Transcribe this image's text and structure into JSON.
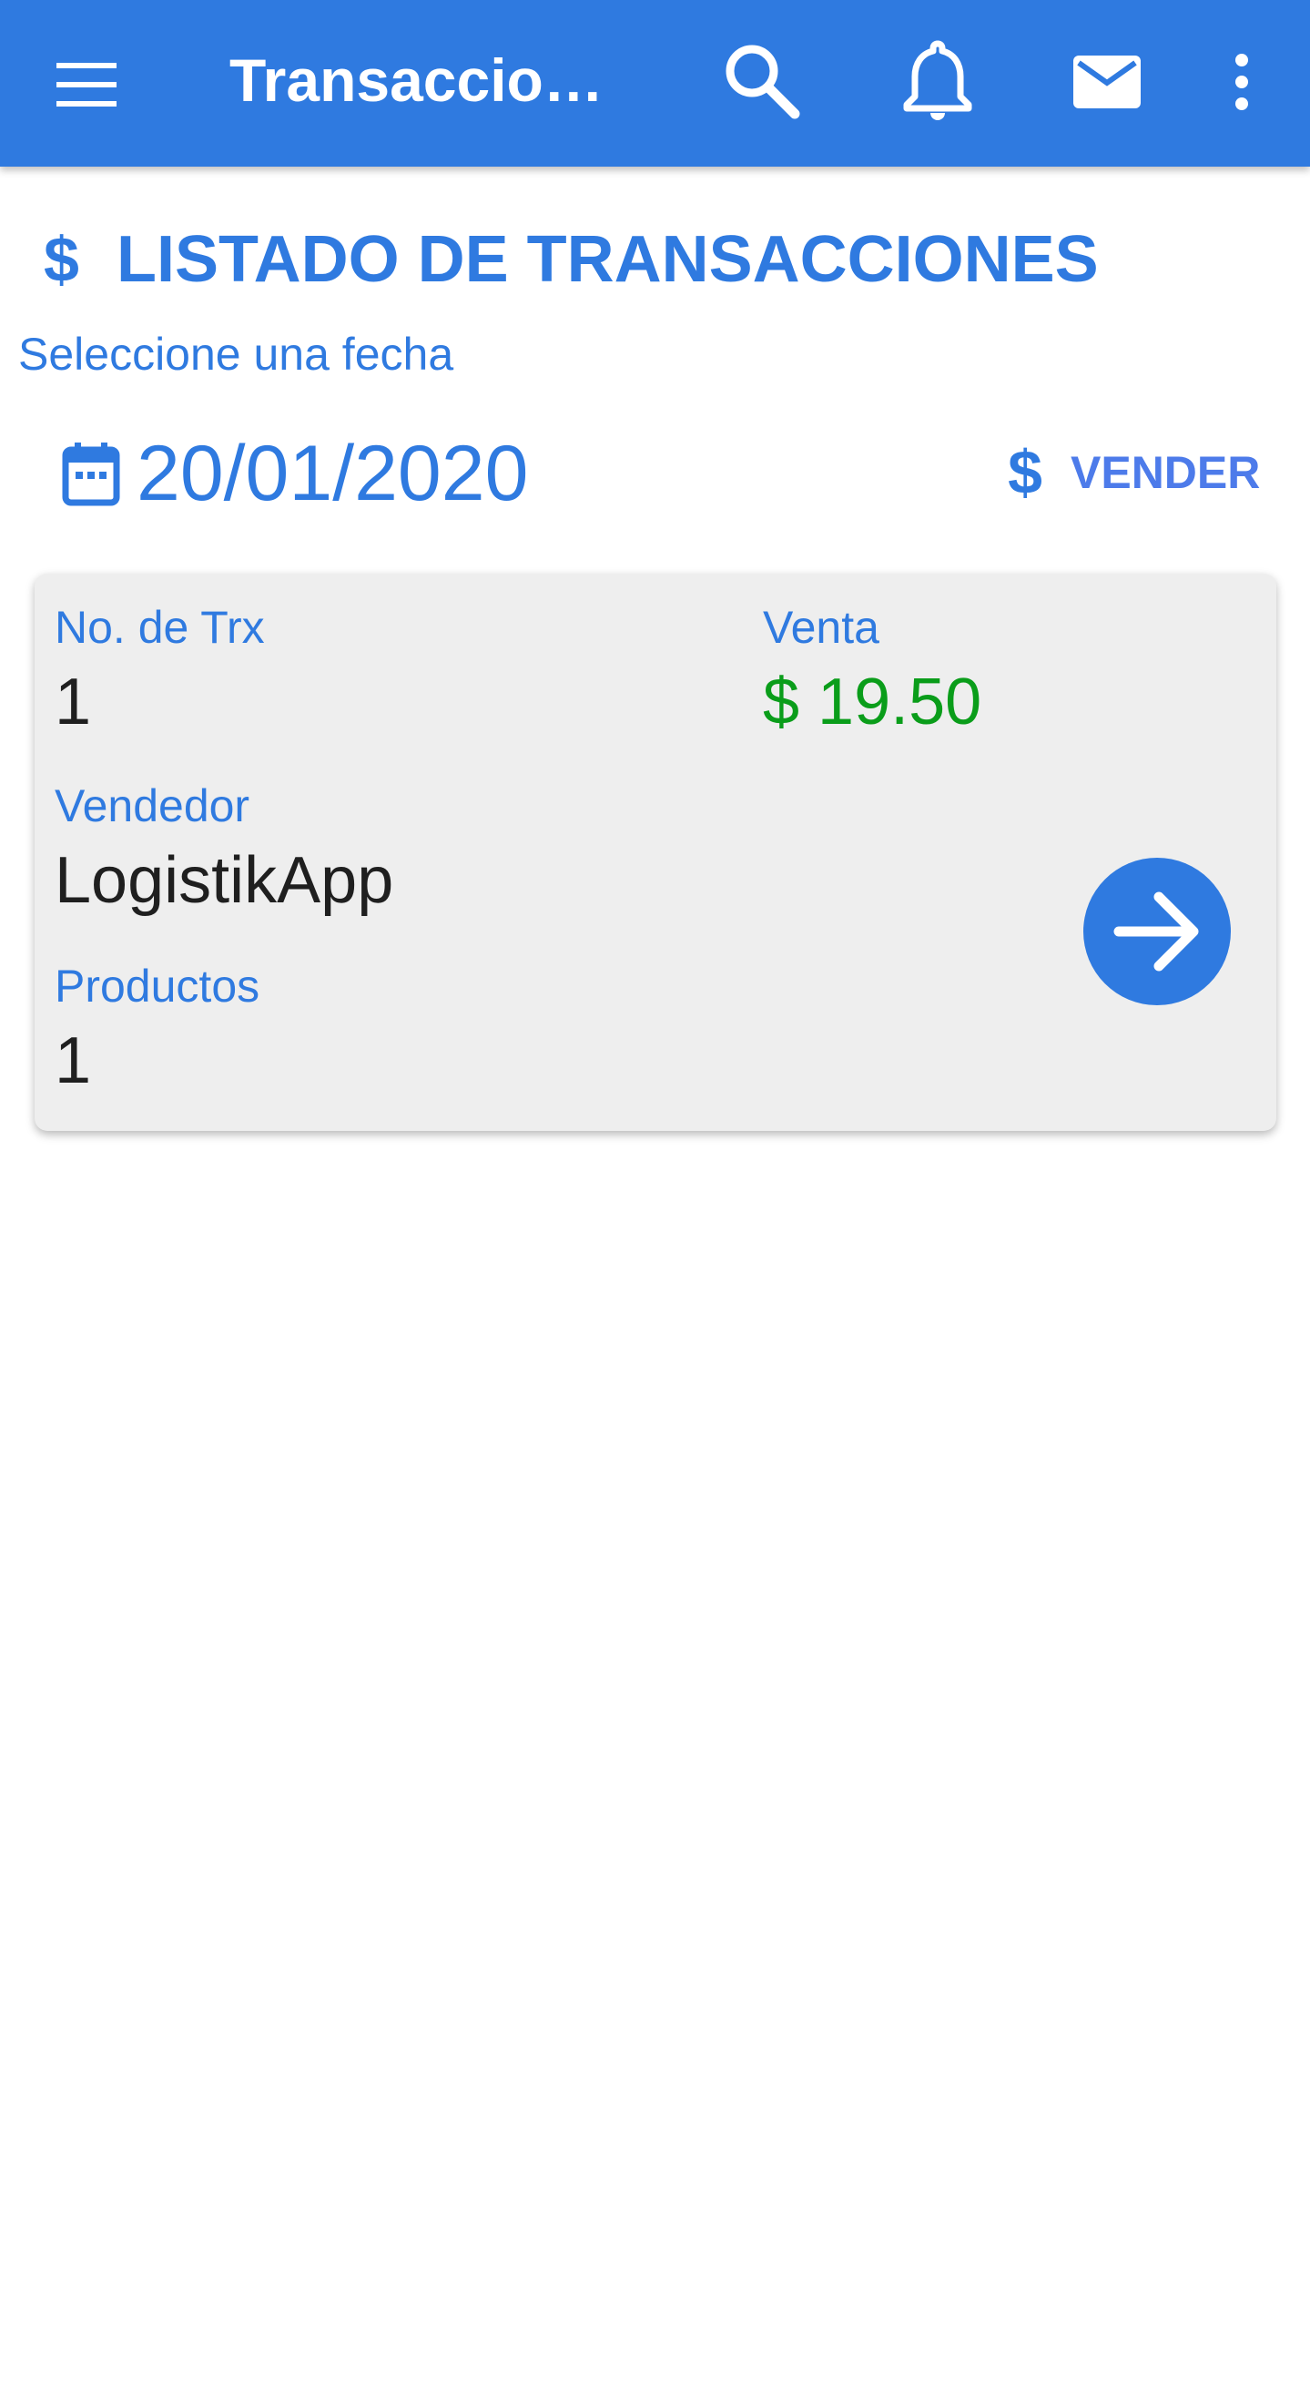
{
  "appbar": {
    "title": "Transaccion…",
    "icons": {
      "menu": "menu-icon",
      "search": "search-icon",
      "notifications": "bell-icon",
      "messages": "mail-icon",
      "more": "more-vert-icon"
    }
  },
  "page": {
    "heading_icon": "$",
    "heading": "LISTADO DE TRANSACCIONES",
    "date_prompt": "Seleccione una fecha",
    "selected_date": "20/01/2020",
    "sell_icon": "$",
    "sell_label": "VENDER"
  },
  "transactions": [
    {
      "trx_label": "No. de Trx",
      "trx_value": "1",
      "sale_label": "Venta",
      "sale_value": "$ 19.50",
      "seller_label": "Vendedor",
      "seller_value": "LogistikApp",
      "products_label": "Productos",
      "products_value": "1"
    }
  ],
  "colors": {
    "primary": "#2f7ae0",
    "sale_green": "#0a9d1a",
    "card_bg": "#eeeeee",
    "text_dark": "#1f1f1f"
  }
}
